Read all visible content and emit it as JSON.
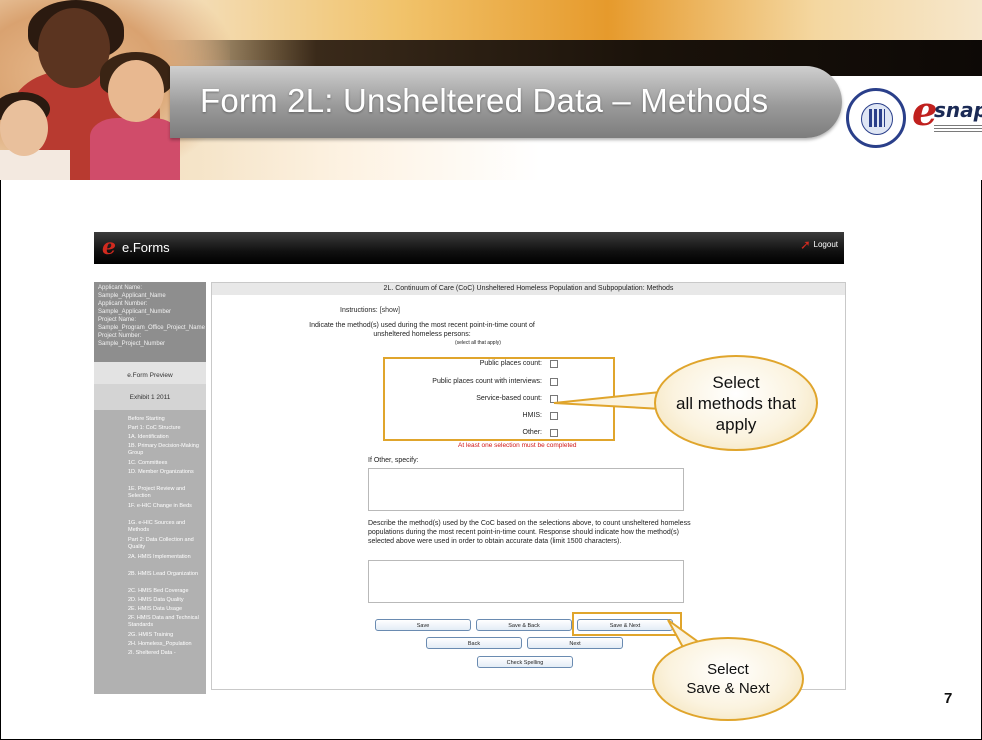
{
  "slide": {
    "title": "Form 2L: Unsheltered Data – Methods",
    "number": "7"
  },
  "app": {
    "name": "e.Forms",
    "logout_label": "Logout"
  },
  "sidebar": {
    "info": [
      "Applicant Name:",
      "Sample_Applicant_Name",
      "Applicant Number:",
      "Sample_Applicant_Number",
      "Project Name:",
      "Sample_Program_Office_Project_Name",
      "Project Number:",
      "Sample_Project_Number"
    ],
    "tabs": [
      "e.Form Preview",
      "Exhibit 1 2011"
    ],
    "nav": [
      "Before Starting",
      "Part 1: CoC Structure",
      "1A. Identification",
      "1B. Primary Decision-Making Group",
      "1C. Committees",
      "1D. Member Organizations",
      "1E. Project Review and Selection",
      "1F. e-HIC Change in Beds",
      "1G. e-HIC Sources and Methods",
      "Part 2: Data Collection and Quality",
      "2A. HMIS Implementation",
      "2B. HMIS Lead Organization",
      "2C. HMIS Bed Coverage",
      "2D. HMIS Data Quality",
      "2E. HMIS Data Usage",
      "2F. HMIS Data and Technical Standards",
      "2G. HMIS Training",
      "2H. Homeless_Population",
      "2I. Sheltered Data -"
    ]
  },
  "form": {
    "header": "2L. Continuum of Care (CoC) Unsheltered Homeless Population and Subpopulation: Methods",
    "instructions_label": "Instructions:",
    "instructions_link": "[show]",
    "prompt": "Indicate the method(s) used during the most recent point-in-time count of unsheltered homeless persons:",
    "prompt_note": "(select all that apply)",
    "methods": [
      {
        "label": "Public places count:",
        "checked": false
      },
      {
        "label": "Public places count with interviews:",
        "checked": false
      },
      {
        "label": "Service-based count:",
        "checked": false
      },
      {
        "label": "HMIS:",
        "checked": false
      },
      {
        "label": "Other:",
        "checked": false
      }
    ],
    "required_message": "At least one selection must be completed",
    "other_label": "If Other, specify:",
    "other_value": "",
    "describe_label": "Describe the method(s) used by the CoC based on the selections above, to count unsheltered homeless populations during the most recent point-in-time count. Response should indicate how the method(s) selected above were used in order to obtain accurate data (limit 1500 characters).",
    "describe_value": "",
    "buttons": {
      "save": "Save",
      "save_back": "Save & Back",
      "save_next": "Save & Next",
      "back": "Back",
      "next": "Next",
      "check_spelling": "Check Spelling"
    }
  },
  "callouts": {
    "methods": "Select\nall methods that\napply",
    "save_next": "Select\nSave & Next"
  },
  "colors": {
    "highlight": "#e0a52c",
    "required": "#d01818",
    "logo_red": "#c0201e"
  }
}
